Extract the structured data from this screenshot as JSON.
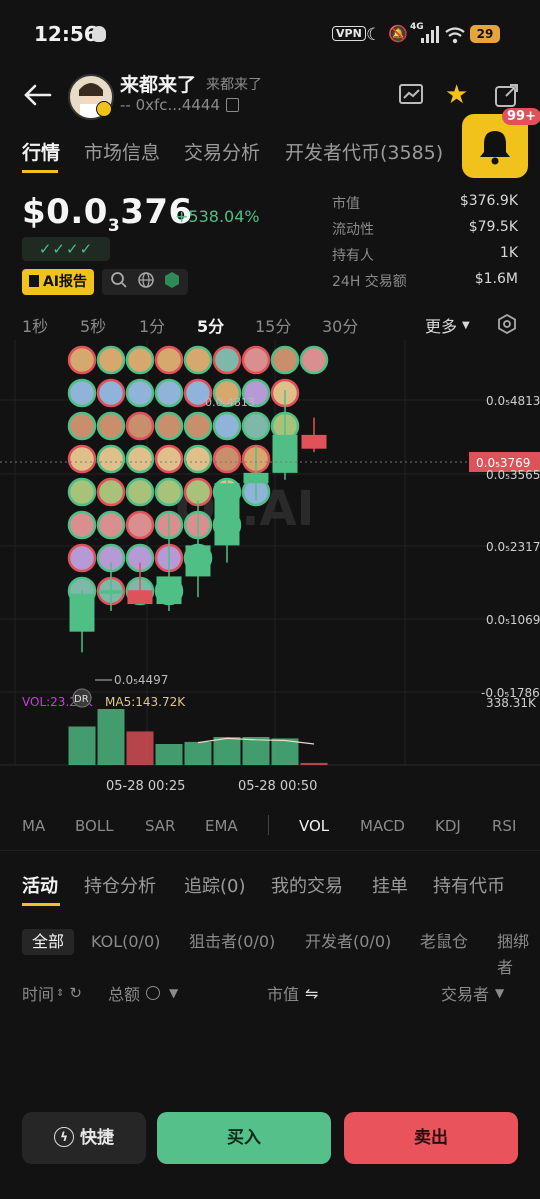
{
  "status_bar": {
    "time": "12:56",
    "vpn": "VPN",
    "network": "4G",
    "battery": "29"
  },
  "header": {
    "token_name": "来都来了",
    "token_subtitle": "来都来了",
    "address": "-- 0xfc...4444",
    "notification_count": "99+"
  },
  "top_tabs": [
    "行情",
    "市场信息",
    "交易分析",
    "开发者代币(3585)"
  ],
  "price": {
    "prefix": "$0.0",
    "subscript": "3",
    "suffix": "376",
    "change": "+538.04%",
    "checks": "✓✓✓✓",
    "ai_report": "AI报告"
  },
  "stats": [
    {
      "label": "市值",
      "value": "$376.9K"
    },
    {
      "label": "流动性",
      "value": "$79.5K"
    },
    {
      "label": "持有人",
      "value": "1K"
    },
    {
      "label": "24H 交易额",
      "value": "$1.6M"
    }
  ],
  "timeframes": [
    "1秒",
    "5秒",
    "1分",
    "5分",
    "15分",
    "30分"
  ],
  "more_label": "更多",
  "chart_labels": {
    "price_levels": [
      "0.0₅4813",
      "0.0₅3565",
      "0.0₅2317",
      "0.0₅1069",
      "-0.0₅1786"
    ],
    "current_price": "0.0₅3769",
    "low_marker": "0.0₅4497",
    "high_marker": "0.0₅4813",
    "vol_label": "VOL:23.28K",
    "ma5_label": "MA5:143.72K",
    "vol_axis": "338.31K",
    "x_ticks": [
      "05-28 00:25",
      "05-28 00:50"
    ],
    "watermark": "OT.AI",
    "dr_tag": "DR"
  },
  "chart_data": {
    "type": "candlestick",
    "candles": [
      {
        "o": 0.7,
        "h": 1.3,
        "l": 0.4,
        "c": 1.25
      },
      {
        "o": 1.25,
        "h": 1.7,
        "l": 1.0,
        "c": 1.3
      },
      {
        "o": 1.3,
        "h": 1.7,
        "l": 1.1,
        "c": 1.1
      },
      {
        "o": 1.1,
        "h": 2.4,
        "l": 1.0,
        "c": 1.5
      },
      {
        "o": 1.5,
        "h": 2.6,
        "l": 1.2,
        "c": 1.95
      },
      {
        "o": 1.95,
        "h": 2.9,
        "l": 1.7,
        "c": 2.85
      },
      {
        "o": 2.85,
        "h": 3.4,
        "l": 2.6,
        "c": 3.0
      },
      {
        "o": 3.0,
        "h": 4.2,
        "l": 2.9,
        "c": 3.55
      },
      {
        "o": 3.55,
        "h": 3.8,
        "l": 3.3,
        "c": 3.35
      }
    ],
    "volumes": [
      55,
      80,
      48,
      30,
      33,
      40,
      40,
      38,
      3
    ],
    "volume_up": [
      true,
      true,
      false,
      true,
      true,
      true,
      true,
      true,
      false
    ],
    "ma5": [
      32,
      38,
      36,
      35,
      30
    ],
    "colors": {
      "up": "#4fbf86",
      "down": "#e0525a"
    }
  },
  "indicators": [
    "MA",
    "BOLL",
    "SAR",
    "EMA",
    "VOL",
    "MACD",
    "KDJ",
    "RSI"
  ],
  "activity_tabs": [
    "活动",
    "持仓分析",
    "追踪(0)",
    "我的交易",
    "挂单",
    "持有代币"
  ],
  "filters": [
    "全部",
    "KOL(0/0)",
    "狙击者(0/0)",
    "开发者(0/0)",
    "老鼠仓",
    "捆绑者"
  ],
  "columns": {
    "time": "时间",
    "amount": "总额",
    "mcap": "市值",
    "trader": "交易者"
  },
  "buttons": {
    "quick": "快捷",
    "buy": "买入",
    "sell": "卖出"
  },
  "colors": {
    "accent": "#f1c21b",
    "up": "#4fbf86",
    "down": "#e0525a",
    "background": "#121212"
  }
}
